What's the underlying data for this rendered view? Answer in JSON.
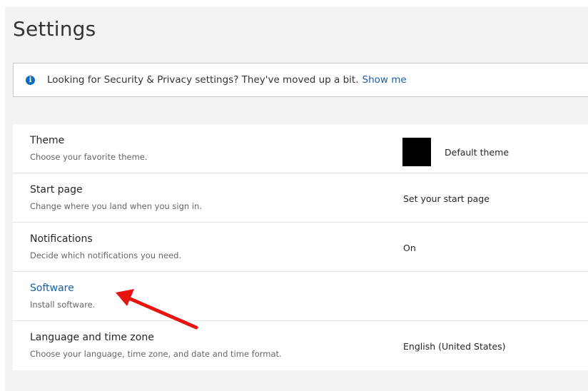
{
  "page": {
    "title": "Settings"
  },
  "banner": {
    "icon": "info-icon",
    "icon_glyph": "i",
    "text": "Looking for Security & Privacy settings? They've moved up a bit.",
    "link_text": "Show me"
  },
  "settings": {
    "theme": {
      "title": "Theme",
      "description": "Choose your favorite theme.",
      "value": "Default theme",
      "swatch_color": "#000000"
    },
    "start_page": {
      "title": "Start page",
      "description": "Change where you land when you sign in.",
      "value": "Set your start page"
    },
    "notifications": {
      "title": "Notifications",
      "description": "Decide which notifications you need.",
      "value": "On"
    },
    "software": {
      "title": "Software",
      "description": "Install software."
    },
    "language": {
      "title": "Language and time zone",
      "description": "Choose your language, time zone, and date and time format.",
      "value": "English (United States)"
    }
  },
  "colors": {
    "panel_background": "#f3f3f3",
    "link": "#1a5fa8",
    "info_icon": "#0f6cbd",
    "annotation_arrow": "#e8140f"
  },
  "annotation": {
    "type": "arrow",
    "points_to": "software"
  }
}
